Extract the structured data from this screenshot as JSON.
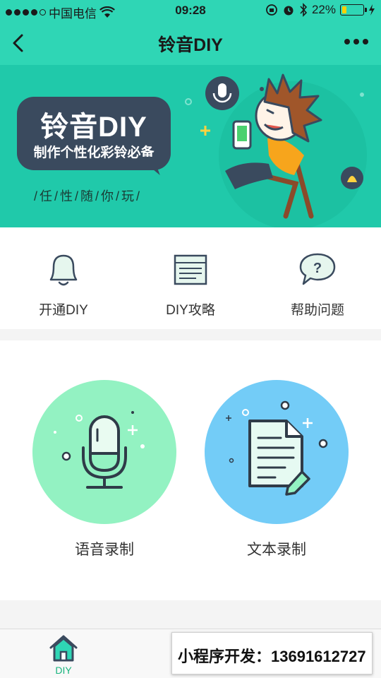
{
  "status_bar": {
    "carrier": "中国电信",
    "time": "09:28",
    "battery": "22%",
    "battery_level": 0.22
  },
  "navbar": {
    "title": "铃音DIY"
  },
  "banner": {
    "title": "铃音DIY",
    "subtitle": "制作个性化彩铃必备",
    "slogan": "/任/性/随/你/玩/"
  },
  "quick_menu": [
    {
      "label": "开通DIY",
      "icon": "bell-icon"
    },
    {
      "label": "DIY攻略",
      "icon": "guide-icon"
    },
    {
      "label": "帮助问题",
      "icon": "help-bubble-icon"
    }
  ],
  "recording": {
    "voice_label": "语音录制",
    "text_label": "文本录制"
  },
  "tabbar": {
    "items": [
      {
        "label": "DIY",
        "icon": "home-icon",
        "active": true
      },
      {
        "label": "",
        "icon": "tab-icon"
      },
      {
        "label": "",
        "icon": "tab-icon"
      }
    ]
  },
  "overlay": {
    "contact_text": "小程序开发：13691612727"
  },
  "colors": {
    "primary": "#2fd6b5",
    "banner": "#20c9aa",
    "voice_circle": "#93f2c2",
    "text_circle": "#73ccf7",
    "active_tab": "#19b47e"
  }
}
